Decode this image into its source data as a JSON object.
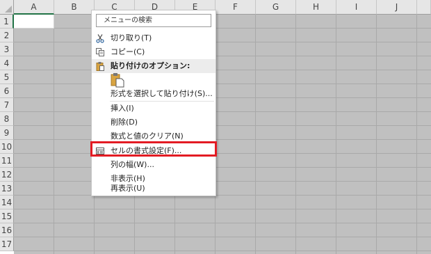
{
  "sheet": {
    "columns": [
      "A",
      "B",
      "C",
      "D",
      "E",
      "F",
      "G",
      "H",
      "I",
      "J"
    ],
    "rows": [
      "1",
      "2",
      "3",
      "4",
      "5",
      "6",
      "7",
      "8",
      "9",
      "10",
      "11",
      "12",
      "13",
      "14",
      "15",
      "16",
      "17"
    ],
    "active_cell": "A1"
  },
  "context_menu": {
    "search_placeholder": "メニューの検索",
    "items": [
      {
        "label": "切り取り(T)",
        "icon": "scissors-icon"
      },
      {
        "label": "コピー(C)",
        "icon": "copy-icon"
      },
      {
        "label": "貼り付けのオプション:",
        "icon": "clipboard-icon"
      },
      {
        "label": "形式を選択して貼り付け(S)..."
      },
      {
        "label": "挿入(I)"
      },
      {
        "label": "削除(D)"
      },
      {
        "label": "数式と値のクリア(N)"
      },
      {
        "label": "セルの書式設定(F)...",
        "icon": "format-cells-icon"
      },
      {
        "label": "列の幅(W)..."
      },
      {
        "label": "非表示(H)"
      },
      {
        "label": "再表示(U)"
      }
    ]
  },
  "highlight_color": "#e31b23",
  "accent_color": "#217346"
}
